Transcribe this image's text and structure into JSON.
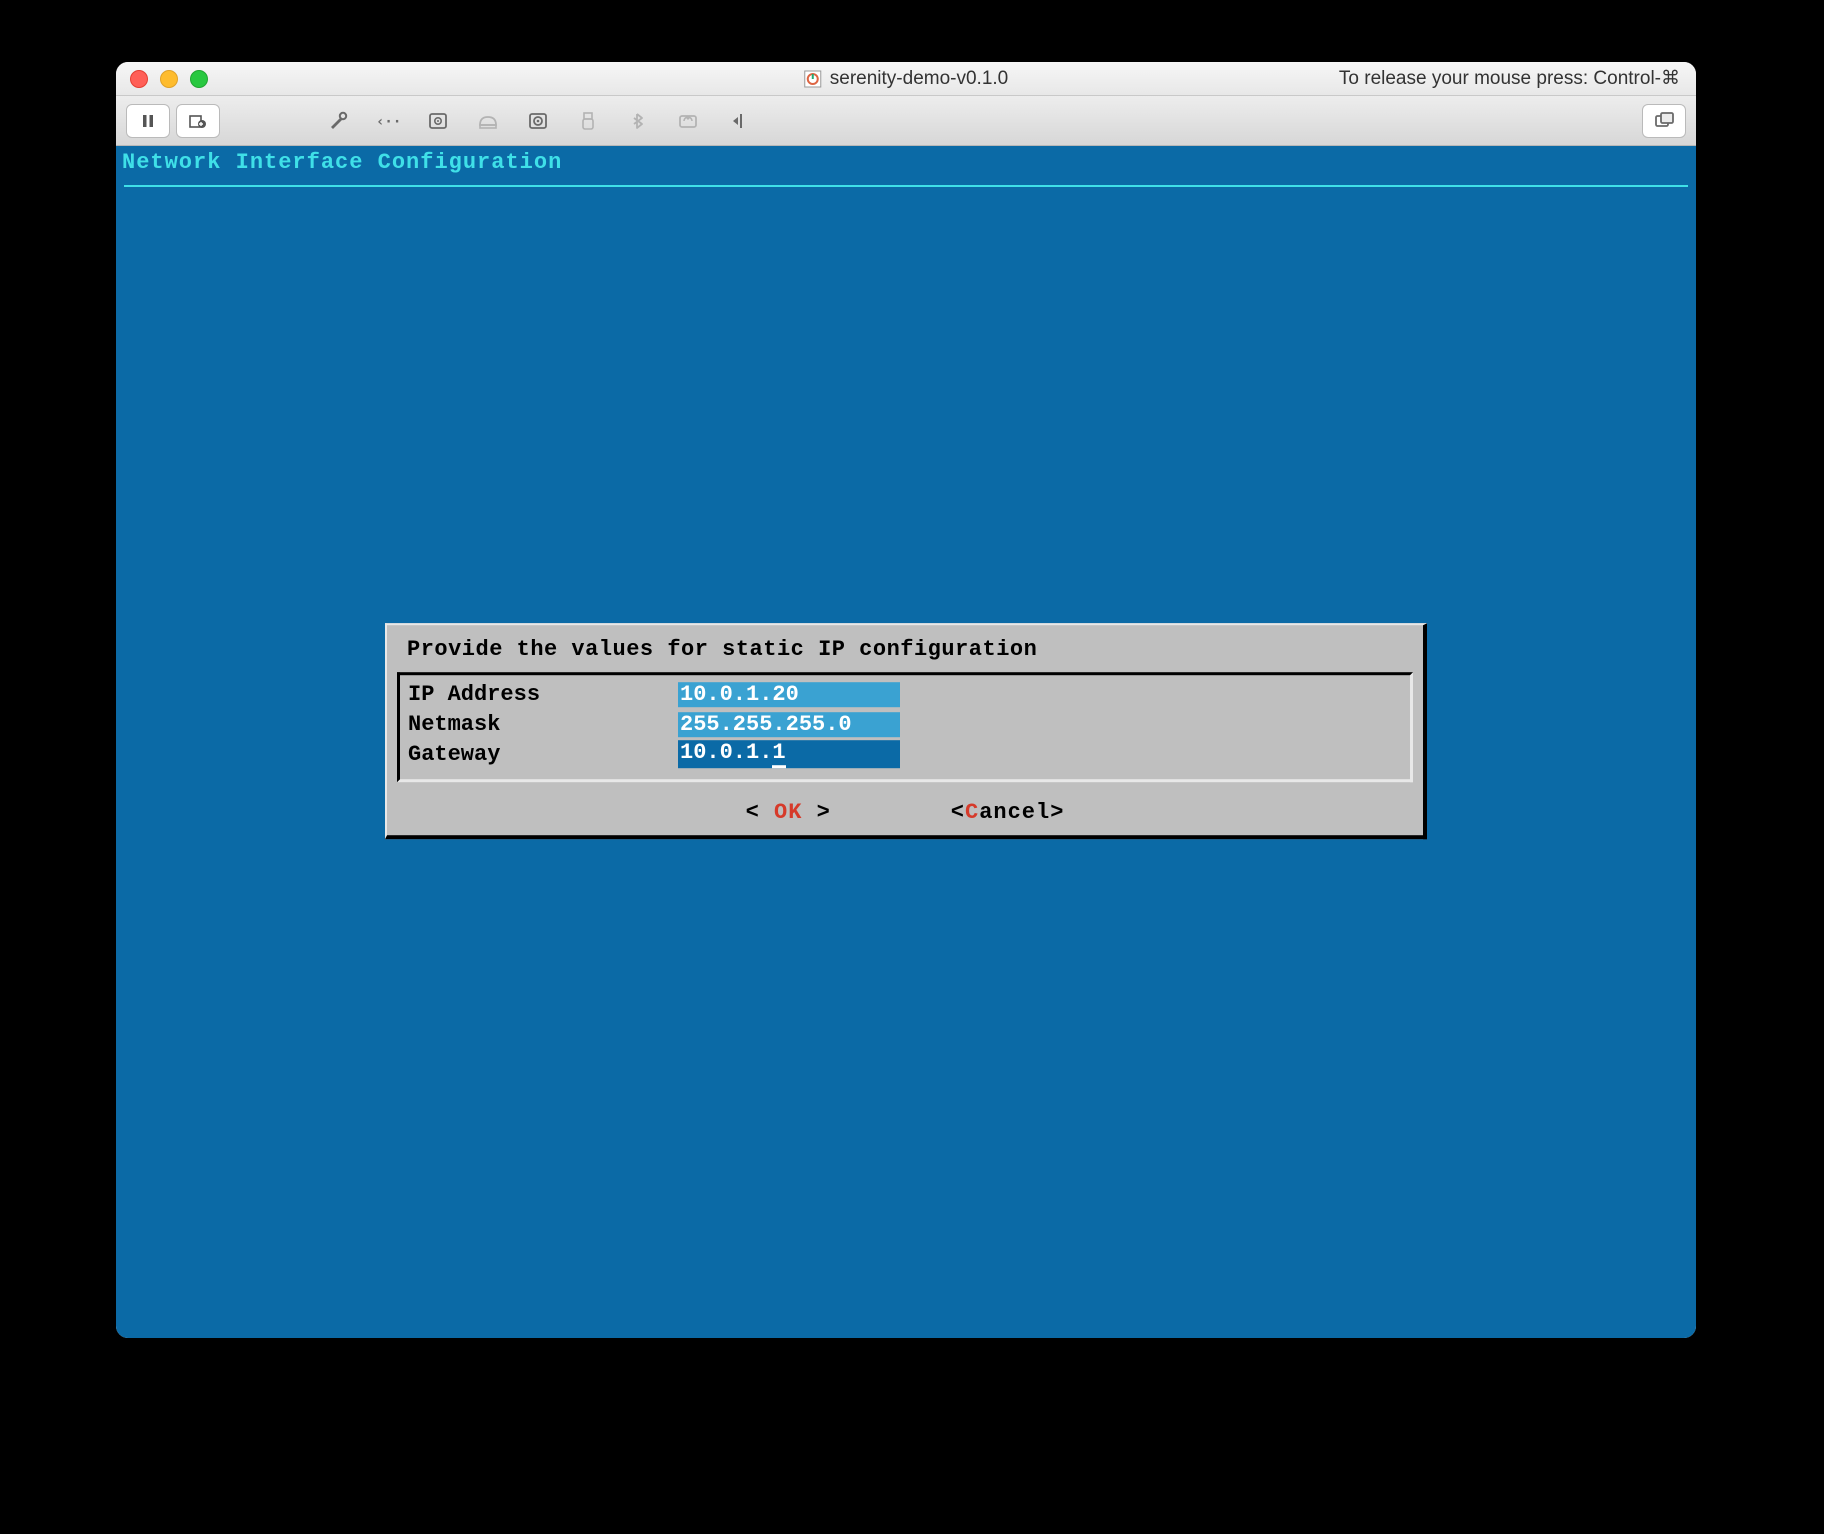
{
  "window": {
    "title": "serenity-demo-v0.1.0",
    "hint": "To release your mouse press: Control-⌘"
  },
  "terminal": {
    "header": "Network Interface Configuration"
  },
  "dialog": {
    "title": "Provide the values for static IP configuration",
    "fields": {
      "ip_label": "IP Address",
      "ip_value": "10.0.1.20",
      "netmask_label": "Netmask",
      "netmask_value": "255.255.255.0",
      "gateway_label": "Gateway",
      "gateway_value": "10.0.1.1"
    },
    "buttons": {
      "ok_open": "<  ",
      "ok_hot": "O",
      "ok_rest": "K",
      "ok_close": "  >",
      "cancel_open": "<",
      "cancel_hot": "C",
      "cancel_rest": "ancel",
      "cancel_close": ">"
    }
  }
}
